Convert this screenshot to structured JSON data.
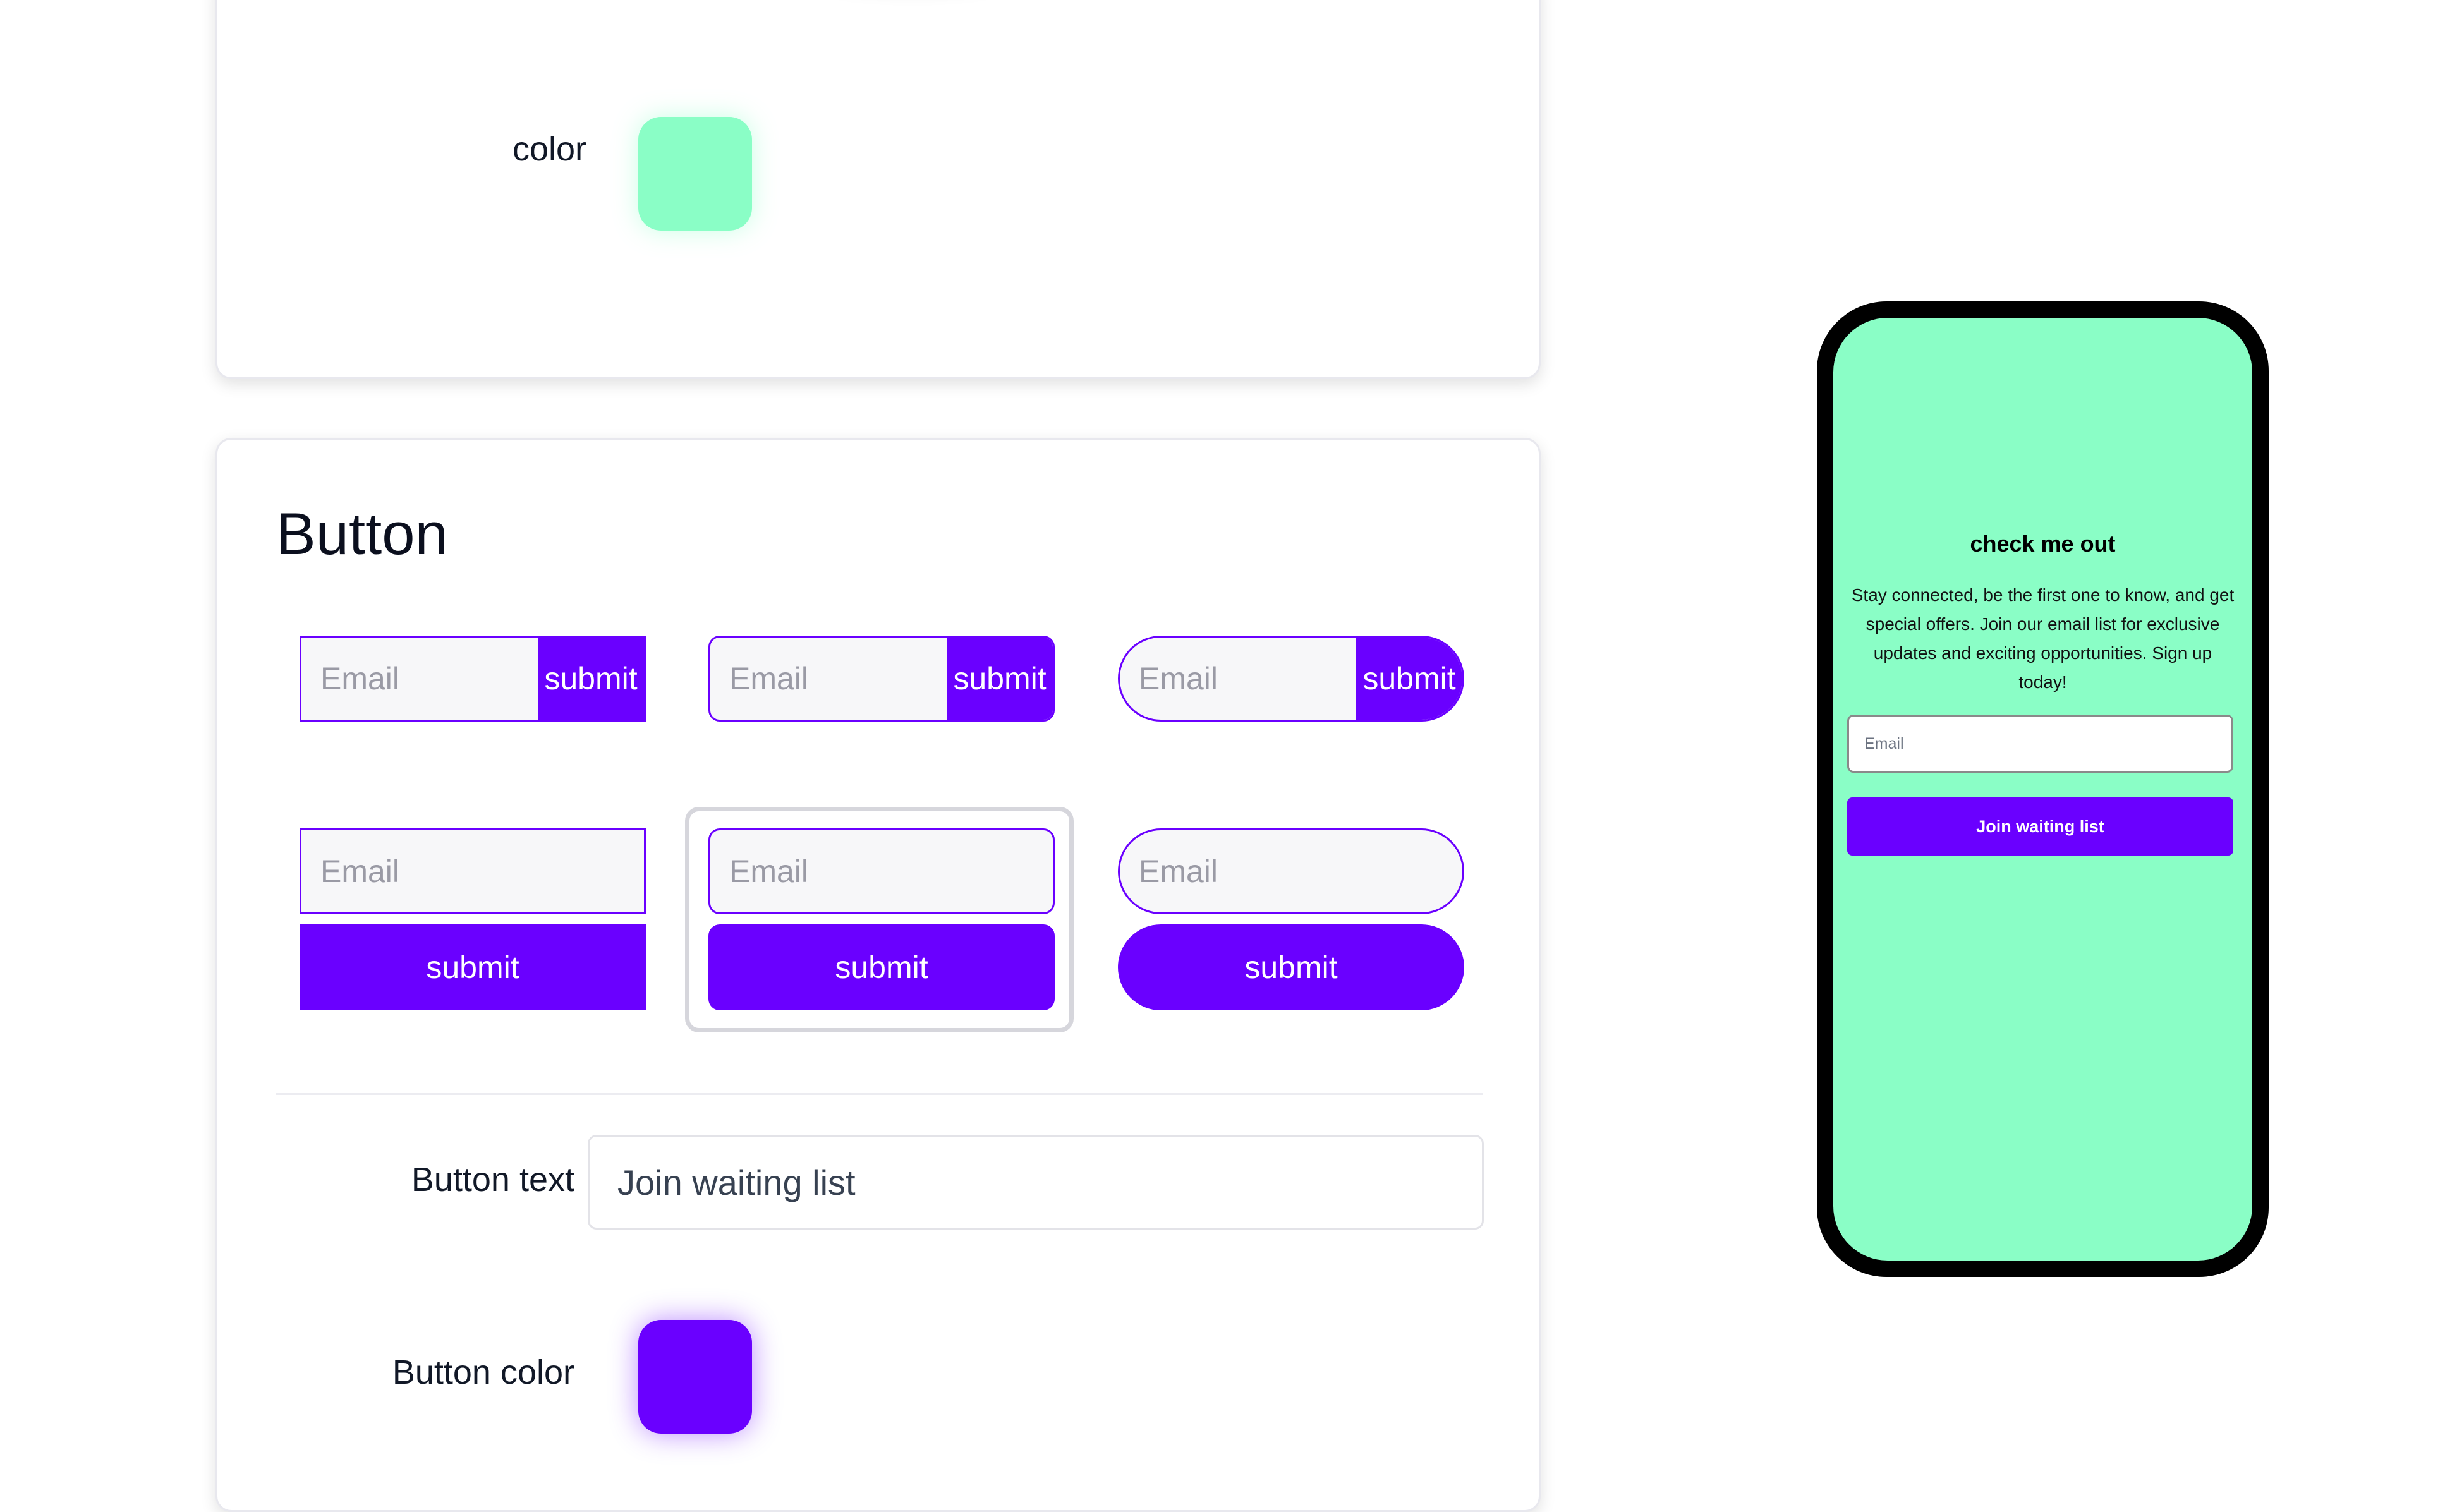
{
  "colors": {
    "background_swatch": "#8afec6",
    "button_swatch": "#6a00ff"
  },
  "top_card": {
    "color_label": "color"
  },
  "button_card": {
    "title": "Button",
    "variants": [
      {
        "style": "inline-square",
        "placeholder": "Email",
        "button": "submit"
      },
      {
        "style": "inline-rounded",
        "placeholder": "Email",
        "button": "submit"
      },
      {
        "style": "inline-pill",
        "placeholder": "Email",
        "button": "submit"
      },
      {
        "style": "stacked-square",
        "placeholder": "Email",
        "button": "submit"
      },
      {
        "style": "stacked-rounded",
        "placeholder": "Email",
        "button": "submit",
        "selected": true
      },
      {
        "style": "stacked-pill",
        "placeholder": "Email",
        "button": "submit"
      }
    ],
    "button_text_label": "Button text",
    "button_text_value": "Join waiting list",
    "button_color_label": "Button color"
  },
  "preview": {
    "title": "check me out",
    "description": "Stay connected, be the first one to know, and get special offers. Join our email list for exclusive updates and exciting opportunities. Sign up today!",
    "email_placeholder": "Email",
    "button_label": "Join waiting list"
  }
}
